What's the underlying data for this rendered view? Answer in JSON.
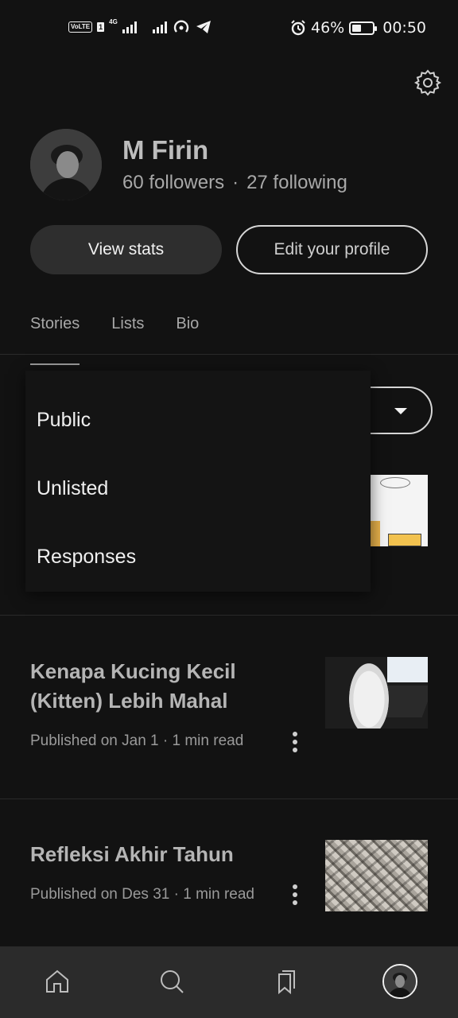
{
  "status_bar": {
    "volte": "VoLTE",
    "sim_slot": "1",
    "network": "4G",
    "battery_percent": "46%",
    "battery_level": 0.46,
    "time": "00:50"
  },
  "profile": {
    "name": "M Firin",
    "followers": "60 followers",
    "separator": "·",
    "following": "27 following"
  },
  "actions": {
    "view_stats": "View stats",
    "edit_profile": "Edit your profile"
  },
  "tabs": [
    {
      "label": "Stories",
      "active": true
    },
    {
      "label": "Lists",
      "active": false
    },
    {
      "label": "Bio",
      "active": false
    }
  ],
  "dropdown": {
    "items": [
      "Public",
      "Unlisted",
      "Responses"
    ]
  },
  "stories": [
    {
      "title": "Kenapa Kucing Kecil (Kitten) Lebih Mahal",
      "meta": "Published on Jan 1 · 1 min read"
    },
    {
      "title": "Refleksi Akhir Tahun",
      "meta": "Published on Des 31 · 1 min read"
    }
  ],
  "nav": {
    "items": [
      "home-icon",
      "search-icon",
      "bookmarks-icon",
      "profile-avatar"
    ]
  },
  "colors": {
    "background": "#121212",
    "bottom_nav": "#2b2b2b",
    "button_fill": "#2e2e2e",
    "text_primary": "#f0f0f0",
    "text_secondary": "#a8a8a8"
  }
}
